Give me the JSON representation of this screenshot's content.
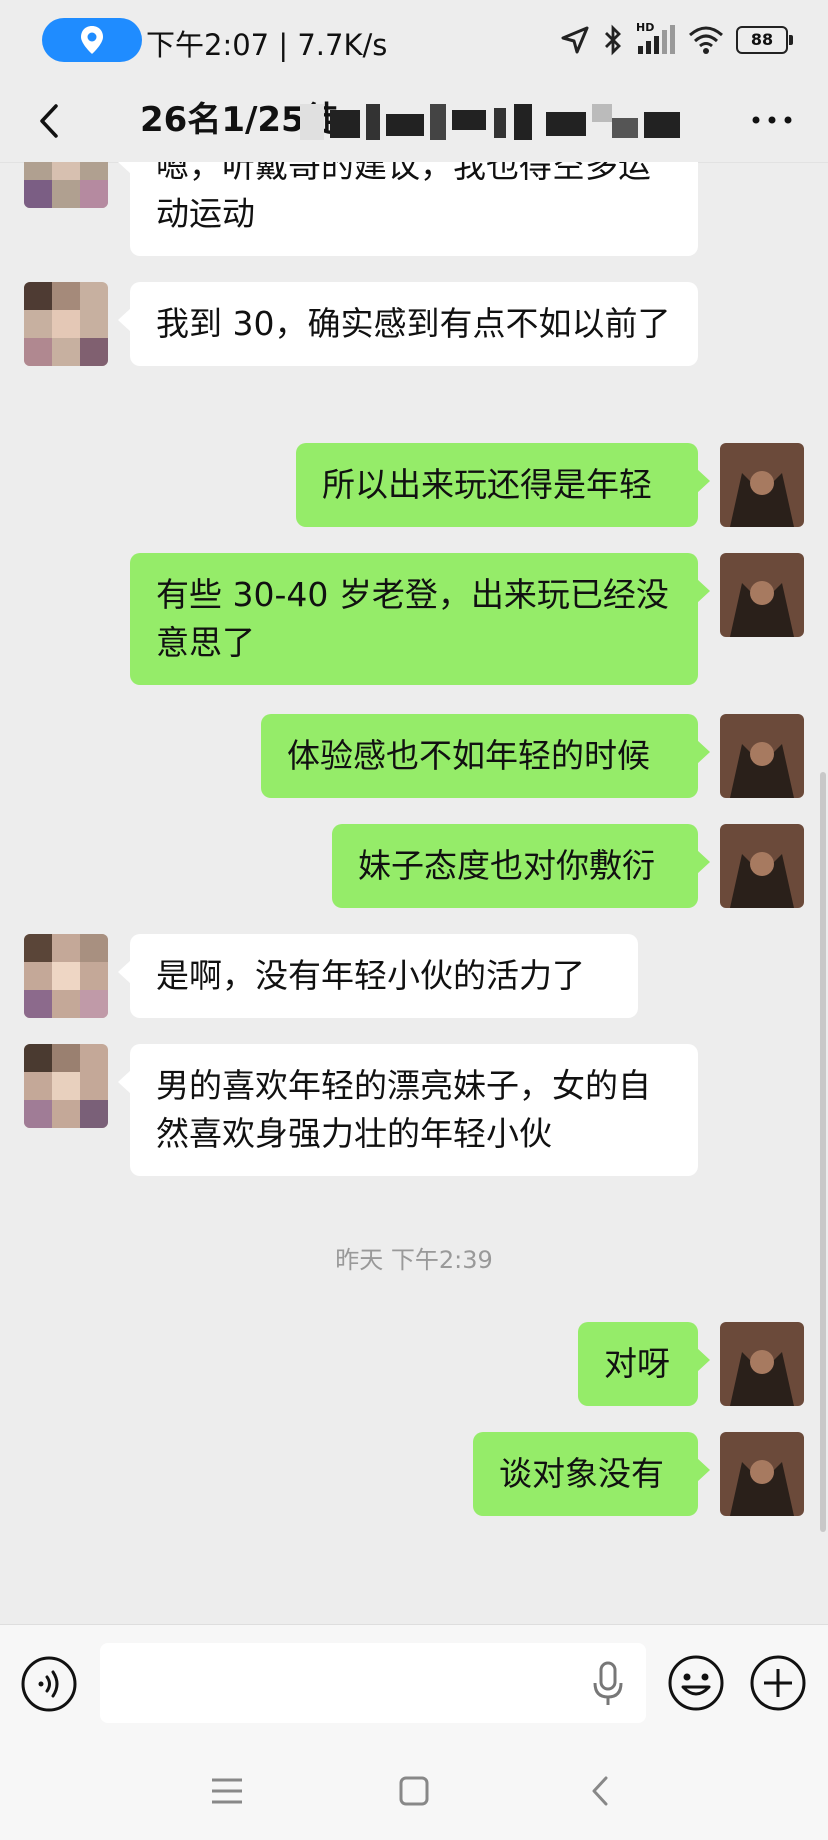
{
  "status_bar": {
    "time_speed": "下午2:07 | 7.7K/s",
    "battery": "88",
    "hd_label": "HD"
  },
  "header": {
    "title": "26名1/25徒"
  },
  "chat": {
    "messages": [
      {
        "side": "other",
        "text": "嗯，听戴哥的建议，我也得空多运动运动"
      },
      {
        "side": "other",
        "text": "我到 30，确实感到有点不如以前了"
      },
      {
        "side": "self",
        "text": "所以出来玩还得是年轻"
      },
      {
        "side": "self",
        "text": "有些 30-40 岁老登，出来玩已经没意思了"
      },
      {
        "side": "self",
        "text": "体验感也不如年轻的时候"
      },
      {
        "side": "self",
        "text": "妹子态度也对你敷衍"
      },
      {
        "side": "other",
        "text": "是啊，没有年轻小伙的活力了"
      },
      {
        "side": "other",
        "text": "男的喜欢年轻的漂亮妹子，女的自然喜欢身强力壮的年轻小伙"
      },
      {
        "side": "self",
        "text": "对呀"
      },
      {
        "side": "self",
        "text": "谈对象没有"
      }
    ],
    "timestamp": "昨天 下午2:39"
  },
  "colors": {
    "self_bubble": "#95ec69",
    "other_bubble": "#ffffff",
    "background": "#ededed",
    "location_pill": "#1f8cff"
  },
  "icons": {
    "back": "chevron-left-icon",
    "more": "more-dots-icon",
    "voice": "voice-icon",
    "mic": "microphone-icon",
    "emoji": "emoji-icon",
    "plus": "plus-icon",
    "location": "location-pin-icon"
  },
  "input": {
    "value": "",
    "placeholder": ""
  }
}
